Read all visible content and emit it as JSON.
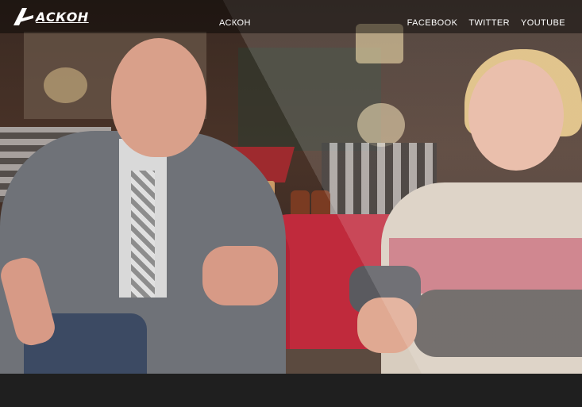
{
  "header": {
    "logo_text": "АСКОН",
    "center_link": "АСКОН",
    "social_links": [
      "FACEBOOK",
      "TWITTER",
      "YOUTUBE"
    ]
  },
  "hero": {
    "scene": "hero-photo"
  },
  "colors": {
    "topbar": "#000000",
    "bottom_bar": "#1f1f1f",
    "text": "#ffffff"
  }
}
